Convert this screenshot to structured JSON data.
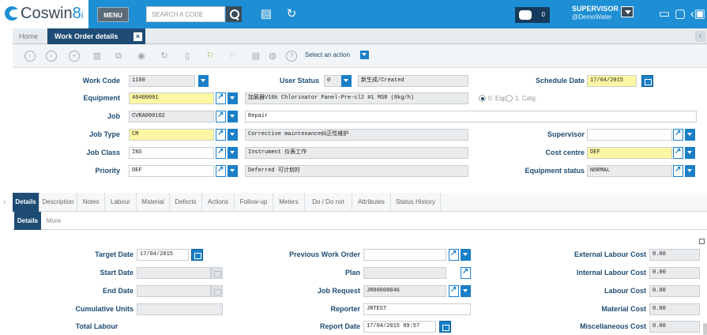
{
  "app": {
    "logo_main": "Coswin",
    "logo_accent": "8",
    "logo_suffix": "i"
  },
  "topbar": {
    "menu_label": "MENU",
    "search_placeholder": "SEARCH A CODE",
    "notifications_count": "0",
    "user_name": "SUPERVISOR",
    "user_org": "@DemoWater"
  },
  "tabs": {
    "home": "Home",
    "active": "Work Order details",
    "close": "×"
  },
  "actionbar": {
    "select_action": "Select an action"
  },
  "header_form": {
    "work_code": {
      "label": "Work Code",
      "value": "1160"
    },
    "user_status": {
      "label": "User Status",
      "code": "0",
      "text": "新生成/Created"
    },
    "schedule_date": {
      "label": "Schedule Date",
      "value": "17/04/2015"
    },
    "equipment": {
      "label": "Equipment",
      "value": "40400001",
      "desc": "加氯器V10k Chlorinator Panel-Pre-cl2 #1 MSR (8kg/h)"
    },
    "radio_eqp": "0. Eqp.",
    "radio_catg": "1. Catg.",
    "job": {
      "label": "Job",
      "value": "CVRA000102",
      "desc": "Repair"
    },
    "job_type": {
      "label": "Job Type",
      "value": "CM",
      "desc": "Corrective maintenance纠正性维护"
    },
    "supervisor": {
      "label": "Supervisor",
      "value": ""
    },
    "job_class": {
      "label": "Job Class",
      "value": "INS",
      "desc": "Instrument 仪表工作"
    },
    "cost_centre": {
      "label": "Cost centre",
      "value": "DEF"
    },
    "priority": {
      "label": "Priority",
      "value": "DEF",
      "desc": "Deferred 可计划的"
    },
    "equipment_status": {
      "label": "Equipment status",
      "value": "NORMAL"
    }
  },
  "detail_tabs": [
    "Details",
    "Description",
    "Notes",
    "Labour",
    "Material",
    "Defects",
    "Actions",
    "Follow-up",
    "Meters",
    "Do / Do not",
    "Attributes",
    "Status History"
  ],
  "sub_tabs": [
    "Details",
    "More"
  ],
  "detail_form": {
    "target_date": {
      "label": "Target Date",
      "value": "17/04/2015"
    },
    "start_date": {
      "label": "Start Date",
      "value": ""
    },
    "end_date": {
      "label": "End Date",
      "value": ""
    },
    "cumulative_units": {
      "label": "Cumulative Units",
      "value": ""
    },
    "total_labour": {
      "label": "Total Labour"
    },
    "previous_work_order": {
      "label": "Previous Work Order",
      "value": ""
    },
    "plan": {
      "label": "Plan",
      "value": ""
    },
    "job_request": {
      "label": "Job Request",
      "value": "JR00000046"
    },
    "reporter": {
      "label": "Reporter",
      "value": "JRTEST"
    },
    "report_date": {
      "label": "Report Date",
      "value": "17/04/2015 09:57"
    },
    "external_labour_cost": {
      "label": "External Labour Cost",
      "value": "0.00"
    },
    "internal_labour_cost": {
      "label": "Internal Labour Cost",
      "value": "0.00"
    },
    "labour_cost": {
      "label": "Labour Cost",
      "value": "0.00"
    },
    "material_cost": {
      "label": "Material Cost",
      "value": "0.00"
    },
    "miscellaneous_cost": {
      "label": "Miscellaneous Cost",
      "value": "0.00"
    }
  }
}
